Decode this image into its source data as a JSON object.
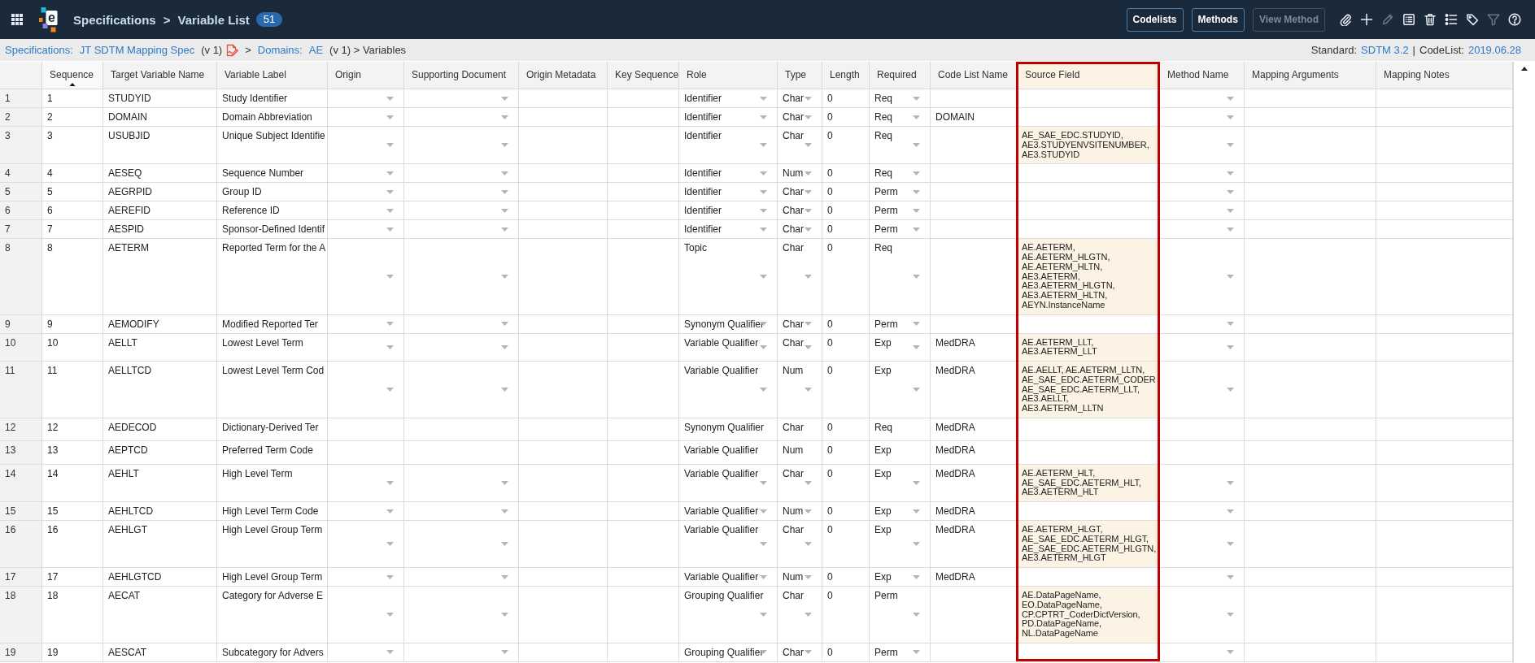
{
  "app_bar": {
    "logo": {
      "letter": "e"
    },
    "section": "Specifications",
    "separator": ">",
    "page": "Variable List",
    "count": "51",
    "buttons": [
      {
        "label": "Codelists",
        "disabled": false
      },
      {
        "label": "Methods",
        "disabled": false
      },
      {
        "label": "View Method",
        "disabled": true
      }
    ],
    "tool_icons": [
      {
        "disabled": false
      },
      {
        "disabled": false
      },
      {
        "disabled": true
      },
      {
        "disabled": false
      },
      {
        "disabled": false
      },
      {
        "disabled": false
      },
      {
        "disabled": false
      },
      {
        "disabled": true
      },
      {
        "disabled": false
      }
    ]
  },
  "breadcrumb": {
    "path": [
      {
        "kind": "link",
        "text": "Specifications:"
      },
      {
        "kind": "link",
        "text": "JT SDTM Mapping Spec"
      },
      {
        "kind": "text",
        "text": "(v 1)"
      },
      {
        "kind": "icon"
      },
      {
        "kind": "text",
        "text": ">"
      },
      {
        "kind": "link",
        "text": "Domains:"
      },
      {
        "kind": "link",
        "text": "AE"
      },
      {
        "kind": "text",
        "text": "(v 1) > Variables"
      }
    ],
    "standard": [
      {
        "kind": "text",
        "text": "Standard:"
      },
      {
        "kind": "link",
        "text": "SDTM 3.2"
      },
      {
        "kind": "text",
        "text": "|"
      },
      {
        "kind": "text",
        "text": "CodeList:"
      },
      {
        "kind": "link",
        "text": "2019.06.28"
      }
    ]
  },
  "table": {
    "columns": [
      {
        "label": "Sequence",
        "kind": "text",
        "sorted": true,
        "highlighted": false
      },
      {
        "label": "Target Variable Name",
        "kind": "text",
        "sorted": false,
        "highlighted": false
      },
      {
        "label": "Variable Label",
        "kind": "text",
        "sorted": false,
        "highlighted": false
      },
      {
        "label": "Origin",
        "kind": "dropdown",
        "sorted": false,
        "highlighted": false
      },
      {
        "label": "Supporting Document",
        "kind": "dropdown",
        "sorted": false,
        "highlighted": false
      },
      {
        "label": "Origin Metadata",
        "kind": "text",
        "sorted": false,
        "highlighted": false
      },
      {
        "label": "Key Sequence",
        "kind": "text",
        "sorted": false,
        "highlighted": false
      },
      {
        "label": "Role",
        "kind": "dropdown",
        "sorted": false,
        "highlighted": false
      },
      {
        "label": "Type",
        "kind": "dropdown",
        "sorted": false,
        "highlighted": false
      },
      {
        "label": "Length",
        "kind": "text",
        "sorted": false,
        "highlighted": false
      },
      {
        "label": "Required",
        "kind": "dropdown",
        "sorted": false,
        "highlighted": false
      },
      {
        "label": "Code List Name",
        "kind": "text",
        "sorted": false,
        "highlighted": false
      },
      {
        "label": "Source Field",
        "kind": "text",
        "sorted": false,
        "highlighted": true
      },
      {
        "label": "Method Name",
        "kind": "dropdown",
        "sorted": false,
        "highlighted": false
      },
      {
        "label": "Mapping Arguments",
        "kind": "text",
        "sorted": false,
        "highlighted": false
      },
      {
        "label": "Mapping Notes",
        "kind": "text",
        "sorted": false,
        "highlighted": false
      }
    ],
    "rows": [
      {
        "number": "1",
        "editable": true,
        "sequence": "1",
        "target_variable_name": "STUDYID",
        "variable_label": "Study Identifier",
        "role": "Identifier",
        "type": "Char",
        "length": "0",
        "required": "Req"
      },
      {
        "number": "2",
        "editable": true,
        "sequence": "2",
        "target_variable_name": "DOMAIN",
        "variable_label": "Domain Abbreviation",
        "role": "Identifier",
        "type": "Char",
        "length": "0",
        "required": "Req",
        "code_list_name": "DOMAIN"
      },
      {
        "number": "3",
        "editable": true,
        "sequence": "3",
        "target_variable_name": "USUBJID",
        "variable_label": "Unique Subject Identifie",
        "role": "Identifier",
        "type": "Char",
        "length": "0",
        "required": "Req",
        "source_field": "AE_SAE_EDC.STUDYID,\nAE3.STUDYENVSITENUMBER,\nAE3.STUDYID"
      },
      {
        "number": "4",
        "editable": true,
        "sequence": "4",
        "target_variable_name": "AESEQ",
        "variable_label": "Sequence Number",
        "role": "Identifier",
        "type": "Num",
        "length": "0",
        "required": "Req"
      },
      {
        "number": "5",
        "editable": true,
        "sequence": "5",
        "target_variable_name": "AEGRPID",
        "variable_label": "Group ID",
        "role": "Identifier",
        "type": "Char",
        "length": "0",
        "required": "Perm"
      },
      {
        "number": "6",
        "editable": true,
        "sequence": "6",
        "target_variable_name": "AEREFID",
        "variable_label": "Reference ID",
        "role": "Identifier",
        "type": "Char",
        "length": "0",
        "required": "Perm"
      },
      {
        "number": "7",
        "editable": true,
        "sequence": "7",
        "target_variable_name": "AESPID",
        "variable_label": "Sponsor-Defined Identif",
        "role": "Identifier",
        "type": "Char",
        "length": "0",
        "required": "Perm"
      },
      {
        "number": "8",
        "editable": true,
        "sequence": "8",
        "target_variable_name": "AETERM",
        "variable_label": "Reported Term for the A",
        "role": "Topic",
        "type": "Char",
        "length": "0",
        "required": "Req",
        "source_field": "AE.AETERM,\nAE.AETERM_HLGTN,\nAE.AETERM_HLTN,\nAE3.AETERM,\nAE3.AETERM_HLGTN,\nAE3.AETERM_HLTN,\nAEYN.InstanceName"
      },
      {
        "number": "9",
        "editable": true,
        "sequence": "9",
        "target_variable_name": "AEMODIFY",
        "variable_label": "Modified Reported Ter",
        "role": "Synonym Qualifier",
        "type": "Char",
        "length": "0",
        "required": "Perm"
      },
      {
        "number": "10",
        "editable": true,
        "sequence": "10",
        "target_variable_name": "AELLT",
        "variable_label": "Lowest Level Term",
        "role": "Variable Qualifier",
        "type": "Char",
        "length": "0",
        "required": "Exp",
        "code_list_name": "MedDRA",
        "source_field": "AE.AETERM_LLT,\nAE3.AETERM_LLT"
      },
      {
        "number": "11",
        "editable": true,
        "sequence": "11",
        "target_variable_name": "AELLTCD",
        "variable_label": "Lowest Level Term Cod",
        "role": "Variable Qualifier",
        "type": "Num",
        "length": "0",
        "required": "Exp",
        "code_list_name": "MedDRA",
        "source_field": "AE.AELLT, AE.AETERM_LLTN,\nAE_SAE_EDC.AETERM_CODER\nAE_SAE_EDC.AETERM_LLT,\nAE3.AELLT,\nAE3.AETERM_LLTN"
      },
      {
        "number": "12",
        "editable": false,
        "sequence": "12",
        "target_variable_name": "AEDECOD",
        "variable_label": "Dictionary-Derived Ter",
        "role": "Synonym Qualifier",
        "type": "Char",
        "length": "0",
        "required": "Req",
        "code_list_name": "MedDRA"
      },
      {
        "number": "13",
        "editable": false,
        "sequence": "13",
        "target_variable_name": "AEPTCD",
        "variable_label": "Preferred Term Code",
        "role": "Variable Qualifier",
        "type": "Num",
        "length": "0",
        "required": "Exp",
        "code_list_name": "MedDRA"
      },
      {
        "number": "14",
        "editable": true,
        "sequence": "14",
        "target_variable_name": "AEHLT",
        "variable_label": "High Level Term",
        "role": "Variable Qualifier",
        "type": "Char",
        "length": "0",
        "required": "Exp",
        "code_list_name": "MedDRA",
        "source_field": "AE.AETERM_HLT,\nAE_SAE_EDC.AETERM_HLT,\nAE3.AETERM_HLT"
      },
      {
        "number": "15",
        "editable": true,
        "sequence": "15",
        "target_variable_name": "AEHLTCD",
        "variable_label": "High Level Term Code",
        "role": "Variable Qualifier",
        "type": "Num",
        "length": "0",
        "required": "Exp",
        "code_list_name": "MedDRA"
      },
      {
        "number": "16",
        "editable": true,
        "sequence": "16",
        "target_variable_name": "AEHLGT",
        "variable_label": "High Level Group Term",
        "role": "Variable Qualifier",
        "type": "Char",
        "length": "0",
        "required": "Exp",
        "code_list_name": "MedDRA",
        "source_field": "AE.AETERM_HLGT,\nAE_SAE_EDC.AETERM_HLGT,\nAE_SAE_EDC.AETERM_HLGTN,\nAE3.AETERM_HLGT"
      },
      {
        "number": "17",
        "editable": true,
        "sequence": "17",
        "target_variable_name": "AEHLGTCD",
        "variable_label": "High Level Group Term",
        "role": "Variable Qualifier",
        "type": "Num",
        "length": "0",
        "required": "Exp",
        "code_list_name": "MedDRA"
      },
      {
        "number": "18",
        "editable": true,
        "sequence": "18",
        "target_variable_name": "AECAT",
        "variable_label": "Category for Adverse E",
        "role": "Grouping Qualifier",
        "type": "Char",
        "length": "0",
        "required": "Perm",
        "source_field": "AE.DataPageName,\nEO.DataPageName,\nCP.CPTRT_CoderDictVersion,\nPD.DataPageName,\nNL.DataPageName"
      },
      {
        "number": "19",
        "editable": true,
        "sequence": "19",
        "target_variable_name": "AESCAT",
        "variable_label": "Subcategory for Advers",
        "role": "Grouping Qualifier",
        "type": "Char",
        "length": "0",
        "required": "Perm"
      }
    ]
  }
}
